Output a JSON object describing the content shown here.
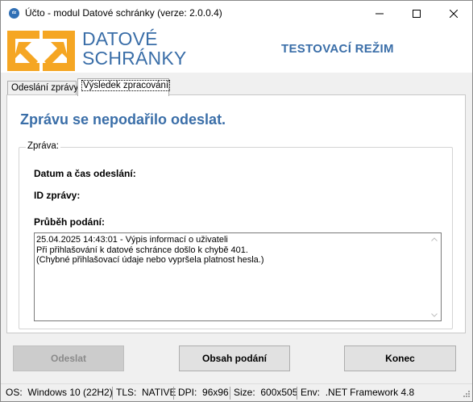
{
  "window": {
    "title": "Účto - modul Datové schránky (verze: 2.0.0.4)",
    "icon_text": "dz"
  },
  "header": {
    "logo_line1": "DATOVÉ",
    "logo_line2": "SCHRÁNKY",
    "mode": "TESTOVACÍ REŽIM",
    "accent_color": "#3a6ea8",
    "logo_color": "#f5a623"
  },
  "tabs": [
    {
      "label": "Odeslání zprávy",
      "selected": false
    },
    {
      "label": "Výsledek zpracování",
      "selected": true
    }
  ],
  "result": {
    "heading": "Zprávu se nepodařilo odeslat.",
    "group_label": "Zpráva:",
    "date_label": "Datum a čas odeslání:",
    "id_label": "ID zprávy:",
    "progress_label": "Průběh podání:",
    "log": "25.04.2025 14:43:01 - Výpis informací o uživateli\nPři přihlašování k datové schránce došlo k chybě 401.\n(Chybné přihlašovací údaje nebo vypršela platnost hesla.)"
  },
  "buttons": {
    "send": "Odeslat",
    "content": "Obsah podání",
    "end": "Konec"
  },
  "status": {
    "os_label": "OS:",
    "os_value": "Windows 10 (22H2)",
    "tls_label": "TLS:",
    "tls_value": "NATIVE",
    "dpi_label": "DPI:",
    "dpi_value": "96x96",
    "size_label": "Size:",
    "size_value": "600x505",
    "env_label": "Env:",
    "env_value": ".NET Framework 4.8"
  }
}
